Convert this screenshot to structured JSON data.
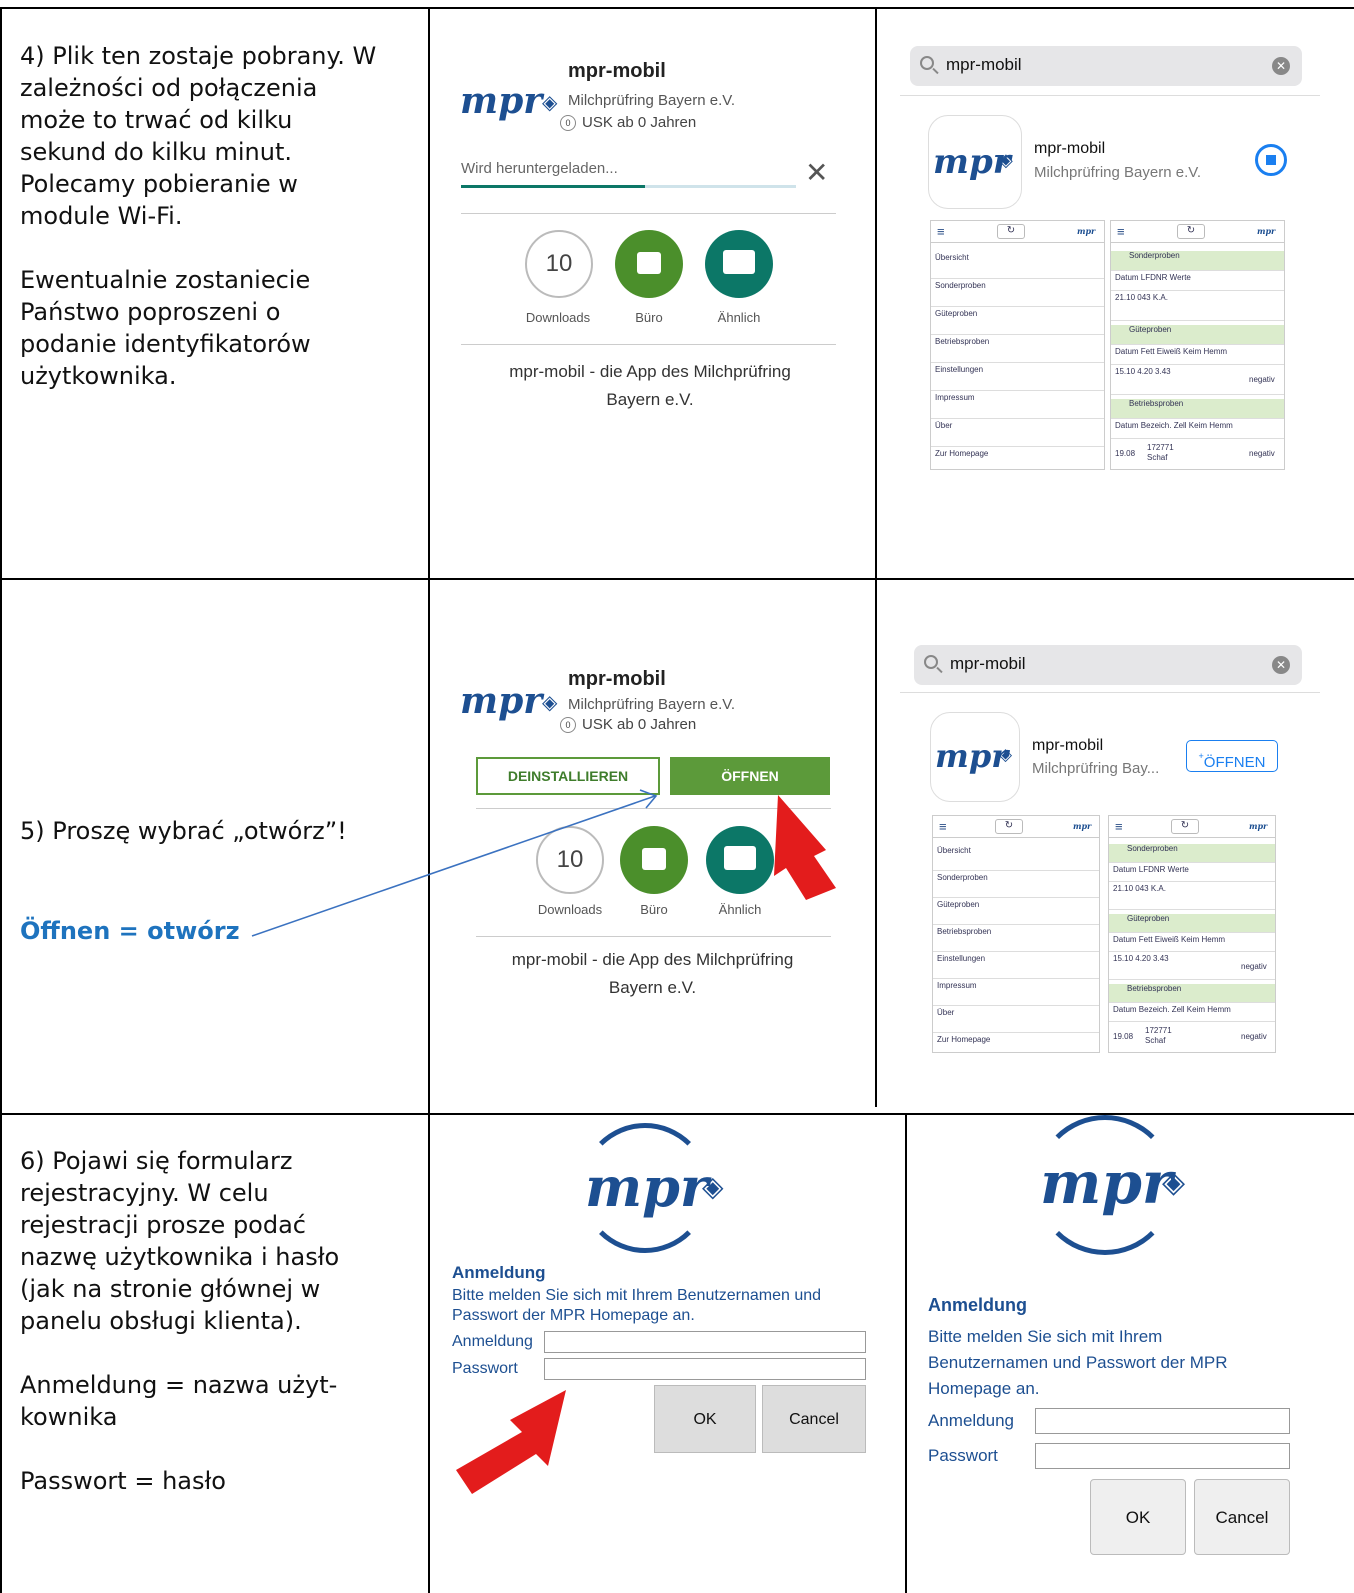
{
  "step4": {
    "lines1": [
      "4) Plik ten zostaje pobrany. W",
      "zależności od połączenia",
      "może to trwać od kilku",
      "sekund do kilku minut.",
      "Polecamy pobieranie w",
      "module Wi-Fi."
    ],
    "lines2": [
      "Ewentualnie zostaniecie",
      "Państwo poproszeni o",
      "podanie identyfikatorów",
      "użytkownika."
    ]
  },
  "step5": {
    "line": "5) Proszę wybrać „otwórz”!",
    "highlight": "Öffnen = otwórz"
  },
  "step6": {
    "lines1": [
      "6) Pojawi się formularz",
      "rejestracyjny. W celu",
      "rejestracji prosze podać",
      "nazwę użytkownika i hasło",
      "(jak na stronie głównej w",
      "panelu obsługi klienta)."
    ],
    "lines2": [
      "Anmeldung  = nazwa użyt-",
      "kownika"
    ],
    "line3": "Passwort = hasło"
  },
  "app": {
    "name": "mpr-mobil",
    "developer": "Milchprüfring Bayern e.V.",
    "developer_short": "Milchprüfring Bay...",
    "usk": "USK ab 0 Jahren",
    "usk_badge": "0",
    "logo_text": "mpr",
    "downloading": "Wird heruntergeladen...",
    "downloads_count": "10",
    "downloads_label": "Downloads",
    "buero_label": "Büro",
    "aehnlich_label": "Ähnlich",
    "description_line1": "mpr-mobil - die App des Milchprüfring",
    "description_line2": "Bayern e.V.",
    "btn_uninstall": "DEINSTALLIEREN",
    "btn_open": "ÖFFNEN",
    "btn_open_ios": "ÖFFNEN",
    "download_progress": 0.55,
    "search_query": "mpr-mobil"
  },
  "mini_app": {
    "menu": [
      "Übersicht",
      "Sonderproben",
      "Güteproben",
      "Betriebsproben",
      "Einstellungen",
      "Impressum",
      "Über",
      "Zur Homepage"
    ],
    "sonder_title": "Sonderproben",
    "sonder_head": "Datum  LFDNR  Werte",
    "sonder_row": "21.10   043      K.A.",
    "guete_title": "Güteproben",
    "guete_head": "Datum  Fett  Eiweiß  Keim  Hemm",
    "guete_row": "15.10  4.20  3.43",
    "guete_neg": "negativ",
    "betrieb_title": "Betriebsproben",
    "betrieb_head": "Datum  Bezeich.     Zell  Keim  Hemm",
    "betrieb_date": "19.08",
    "betrieb_id": "172771",
    "betrieb_kind": "Schaf",
    "betrieb_neg": "negativ"
  },
  "login": {
    "heading": "Anmeldung",
    "text_line1_android": "Bitte melden Sie sich mit Ihrem Benutzernamen und",
    "text_line2_android": "Passwort der MPR Homepage an.",
    "text_line1_ios": "Bitte melden Sie sich mit Ihrem",
    "text_line2_ios": "Benutzernamen und Passwort der MPR",
    "text_line3_ios": "Homepage an.",
    "field_user": "Anmeldung",
    "field_pass": "Passwort",
    "ok": "OK",
    "cancel": "Cancel"
  },
  "colors": {
    "highlight": "#1e73be",
    "brand_blue": "#1d4f91",
    "play_green": "#5c9a3a",
    "ios_blue": "#1a7ff0",
    "arrow_red": "#e31c1c"
  }
}
